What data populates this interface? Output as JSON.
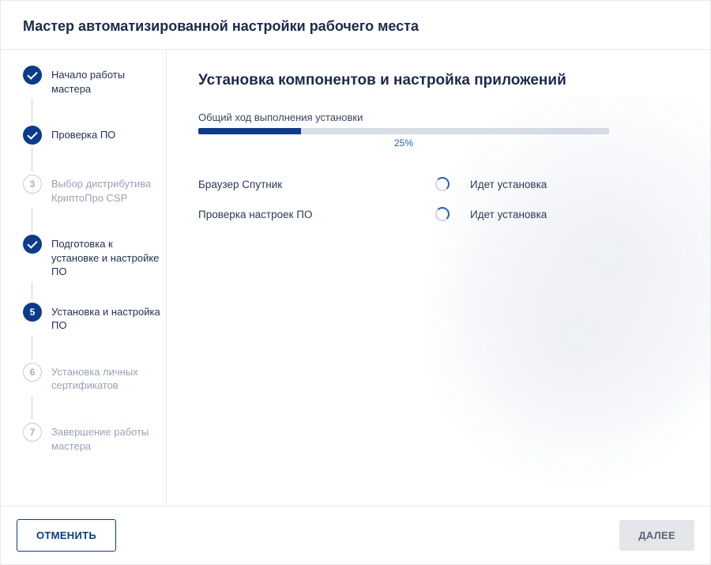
{
  "header": {
    "title": "Мастер автоматизированной настройки рабочего места"
  },
  "sidebar": {
    "steps": [
      {
        "num": "1",
        "label": "Начало работы мастера",
        "state": "done"
      },
      {
        "num": "2",
        "label": "Проверка ПО",
        "state": "done"
      },
      {
        "num": "3",
        "label": "Выбор дистрибутива КриптоПро CSP",
        "state": "pending"
      },
      {
        "num": "4",
        "label": "Подготовка к установке и настройке ПО",
        "state": "done"
      },
      {
        "num": "5",
        "label": "Установка и настройка ПО",
        "state": "current"
      },
      {
        "num": "6",
        "label": "Установка личных сертификатов",
        "state": "pending"
      },
      {
        "num": "7",
        "label": "Завершение работы мастера",
        "state": "pending"
      }
    ]
  },
  "main": {
    "heading": "Установка компонентов и настройка приложений",
    "progress_label": "Общий ход выполнения установки",
    "progress_pct_text": "25%",
    "progress_pct_value": 25,
    "tasks": [
      {
        "name": "Браузер Спутник",
        "status": "Идет установка"
      },
      {
        "name": "Проверка настроек ПО",
        "status": "Идет установка"
      }
    ]
  },
  "footer": {
    "cancel": "ОТМЕНИТЬ",
    "next": "ДАЛЕЕ"
  }
}
